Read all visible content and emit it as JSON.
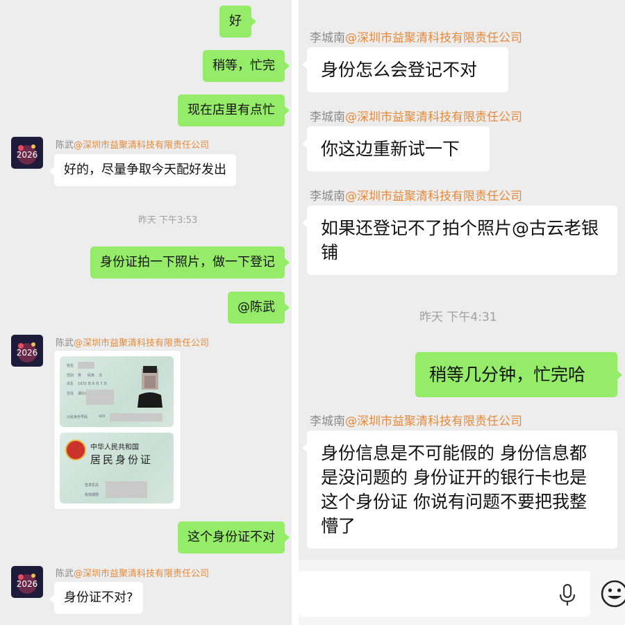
{
  "left_panel": {
    "messages": [
      {
        "type": "out",
        "text": "好"
      },
      {
        "type": "out",
        "text": "稍等，忙完"
      },
      {
        "type": "out",
        "text": "现在店里有点忙"
      },
      {
        "type": "in",
        "sender": "陈武",
        "org": "@深圳市益聚清科技有限责任公司",
        "text": "好的，尽量争取今天配好发出"
      },
      {
        "type": "time",
        "text": "昨天 下午3:53"
      },
      {
        "type": "out",
        "text": "身份证拍一下照片，做一下登记"
      },
      {
        "type": "out",
        "text": "@陈武"
      },
      {
        "type": "in_image",
        "sender": "陈武",
        "org": "@深圳市益聚清科技有限责任公司"
      },
      {
        "type": "out",
        "text": "这个身份证不对"
      },
      {
        "type": "in",
        "sender": "陈武",
        "org": "@深圳市益聚清科技有限责任公司",
        "text": "身份证不对?"
      }
    ],
    "id_card": {
      "front_labels": [
        "姓名",
        "性别",
        "出生",
        "住址",
        "公民身份号码"
      ],
      "sex_value": "男",
      "ethnicity_label": "民族",
      "ethnicity_value": "汉",
      "birth_value": "1972 年 6 月 7 日",
      "address_value": "湖北省1",
      "id_prefix": "420",
      "back_title_1": "中华人民共和国",
      "back_title_2": "居民身份证",
      "back_labels": [
        "签发机关",
        "有效期限"
      ]
    }
  },
  "right_panel": {
    "messages": [
      {
        "type": "in",
        "sender": "李城南",
        "org": "@深圳市益聚清科技有限责任公司",
        "text": "身份怎么会登记不对"
      },
      {
        "type": "in",
        "sender": "李城南",
        "org": "@深圳市益聚清科技有限责任公司",
        "text": "你这边重新试一下"
      },
      {
        "type": "in",
        "sender": "李城南",
        "org": "@深圳市益聚清科技有限责任公司",
        "text": "如果还登记不了拍个照片@古云老银铺"
      },
      {
        "type": "time",
        "text": "昨天 下午4:31"
      },
      {
        "type": "out",
        "text": "稍等几分钟，忙完哈"
      },
      {
        "type": "in",
        "sender": "李城南",
        "org": "@深圳市益聚清科技有限责任公司",
        "text": "身份信息是不可能假的 身份信息都是没问题的 身份证开的银行卡也是这个身份证 你说有问题不要把我整懵了"
      }
    ],
    "input": {
      "placeholder": "",
      "voice_icon": "microphone-icon",
      "emoji_icon": "emoji-icon"
    }
  },
  "colors": {
    "outgoing_bubble": "#95ec69",
    "incoming_bubble": "#ffffff",
    "background": "#ededed",
    "org_text": "#e58a3b",
    "name_text": "#8a8a8a",
    "time_text": "#a0a0a0"
  }
}
